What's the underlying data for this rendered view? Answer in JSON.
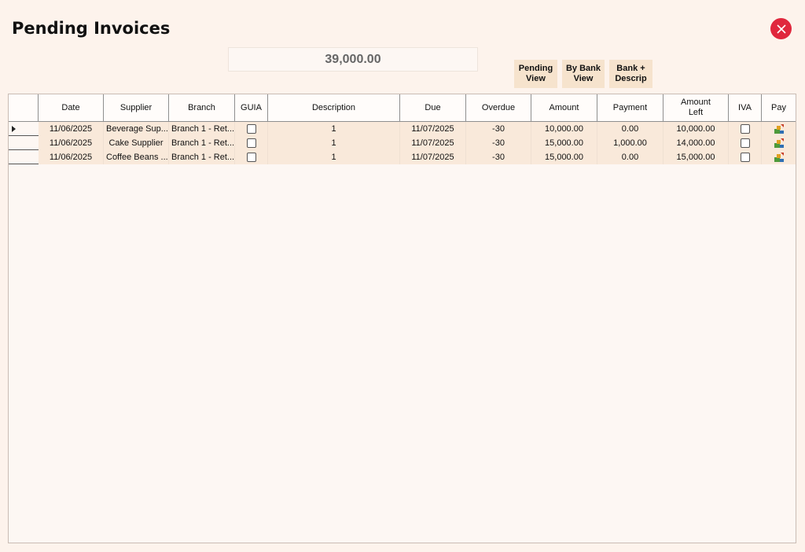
{
  "window": {
    "title": "Pending Invoices"
  },
  "summary": {
    "total": "39,000.00"
  },
  "buttons": {
    "pending_view": "Pending\nView",
    "by_bank_view": "By Bank\nView",
    "bank_descrip": "Bank +\nDescrip"
  },
  "colors": {
    "close": "#e0273d",
    "row_bg": "#f9e9da",
    "button_bg": "#f6e3cd"
  },
  "table": {
    "columns": [
      "Date",
      "Supplier",
      "Branch",
      "GUIA",
      "Description",
      "Due",
      "Overdue",
      "Amount",
      "Payment",
      "Amount\nLeft",
      "IVA",
      "Pay"
    ],
    "rows": [
      {
        "date": "11/06/2025",
        "supplier": "Beverage Sup...",
        "branch": "Branch 1 - Ret...",
        "guia": false,
        "description": "1",
        "due": "11/07/2025",
        "overdue": "-30",
        "amount": "10,000.00",
        "payment": "0.00",
        "amount_left": "10,000.00",
        "iva": false,
        "pay_icon": "pay-money-icon"
      },
      {
        "date": "11/06/2025",
        "supplier": "Cake Supplier",
        "branch": "Branch 1 - Ret...",
        "guia": false,
        "description": "1",
        "due": "11/07/2025",
        "overdue": "-30",
        "amount": "15,000.00",
        "payment": "1,000.00",
        "amount_left": "14,000.00",
        "iva": false,
        "pay_icon": "pay-money-icon"
      },
      {
        "date": "11/06/2025",
        "supplier": "Coffee Beans ...",
        "branch": "Branch 1 - Ret...",
        "guia": false,
        "description": "1",
        "due": "11/07/2025",
        "overdue": "-30",
        "amount": "15,000.00",
        "payment": "0.00",
        "amount_left": "15,000.00",
        "iva": false,
        "pay_icon": "pay-money-icon"
      }
    ]
  }
}
